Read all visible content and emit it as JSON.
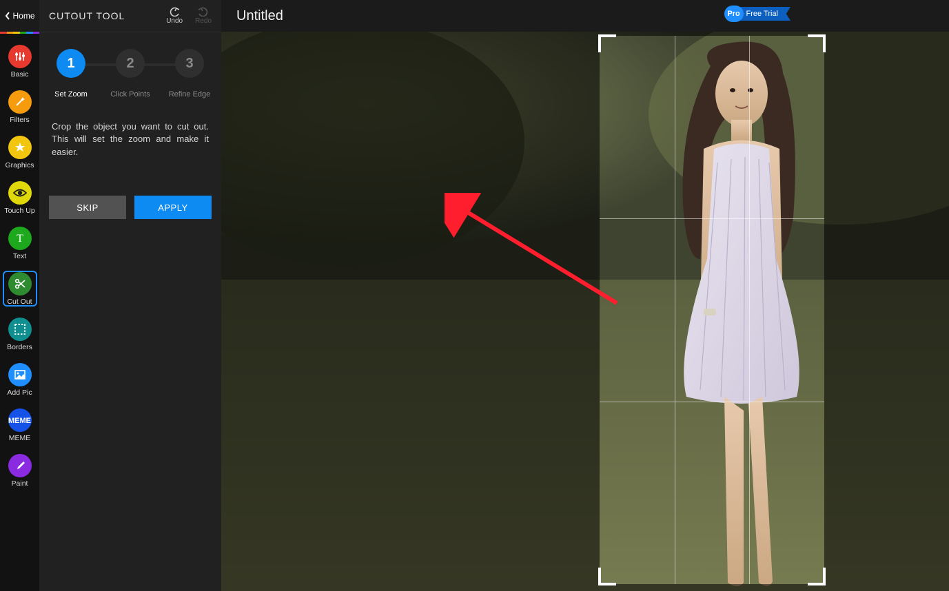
{
  "home_label": "Home",
  "sidebar": {
    "items": [
      {
        "label": "Basic",
        "color": "#e8392f",
        "icon": "sliders"
      },
      {
        "label": "Filters",
        "color": "#f59b0d",
        "icon": "wand"
      },
      {
        "label": "Graphics",
        "color": "#f2c50f",
        "icon": "star"
      },
      {
        "label": "Touch Up",
        "color": "#e0d80a",
        "icon": "eye"
      },
      {
        "label": "Text",
        "color": "#1ea81e",
        "icon": "text"
      },
      {
        "label": "Cut Out",
        "color": "#2f8b2f",
        "icon": "scissors",
        "active": true
      },
      {
        "label": "Borders",
        "color": "#0f8f8f",
        "icon": "frame"
      },
      {
        "label": "Add Pic",
        "color": "#1f8fff",
        "icon": "picture"
      },
      {
        "label": "MEME",
        "color": "#1452e8",
        "icon": "meme"
      },
      {
        "label": "Paint",
        "color": "#8a2be2",
        "icon": "brush"
      }
    ]
  },
  "panel": {
    "title": "CUTOUT TOOL",
    "undo_label": "Undo",
    "redo_label": "Redo",
    "steps": [
      {
        "num": "1",
        "label": "Set Zoom",
        "active": true
      },
      {
        "num": "2",
        "label": "Click Points"
      },
      {
        "num": "3",
        "label": "Refine Edge"
      }
    ],
    "description": "Crop the object you want to cut out. This will set the zoom and make it easier.",
    "skip_label": "SKIP",
    "apply_label": "APPLY"
  },
  "header": {
    "doc_title": "Untitled",
    "pro_label": "Pro",
    "trial_label": "Free Trial"
  }
}
